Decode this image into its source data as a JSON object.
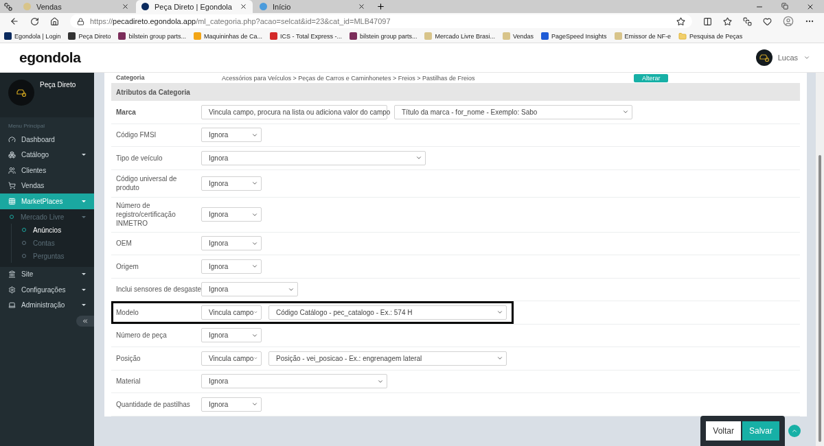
{
  "browser": {
    "tabs": [
      {
        "title": "Vendas",
        "selected": false
      },
      {
        "title": "Peça Direto | Egondola",
        "selected": true
      },
      {
        "title": "Início",
        "selected": false
      }
    ],
    "url": {
      "scheme": "https://",
      "host": "pecadireto.egondola.app",
      "path": "/ml_categoria.php?acao=selcat&id=23&cat_id=MLB47097"
    },
    "bookmarks": [
      {
        "label": "Egondola | Login"
      },
      {
        "label": "Peça Direto"
      },
      {
        "label": "bilstein group parts..."
      },
      {
        "label": "Maquininhas de Ca..."
      },
      {
        "label": "ICS - Total Express -..."
      },
      {
        "label": "bilstein group parts..."
      },
      {
        "label": "Mercado Livre Brasi..."
      },
      {
        "label": "Vendas"
      },
      {
        "label": "PageSpeed Insights"
      },
      {
        "label": "Emissor de NF-e"
      },
      {
        "label": "Pesquisa de Peças"
      }
    ]
  },
  "header": {
    "logo": "egondola",
    "user": "Lucas"
  },
  "sidebar": {
    "brand": "Peça Direto",
    "section_label": "Menu Principal",
    "items": [
      {
        "label": "Dashboard",
        "selected": false,
        "has_submenu": false
      },
      {
        "label": "Catálogo",
        "selected": false,
        "has_submenu": true
      },
      {
        "label": "Clientes",
        "selected": false,
        "has_submenu": false
      },
      {
        "label": "Vendas",
        "selected": false,
        "has_submenu": false
      },
      {
        "label": "MarketPlaces",
        "selected": true,
        "expanded": true,
        "has_submenu": true,
        "children": [
          {
            "label": "Mercado Livre",
            "expanded": true,
            "children": [
              {
                "label": "Anúncios",
                "selected": true
              },
              {
                "label": "Contas",
                "selected": false
              },
              {
                "label": "Perguntas",
                "selected": false
              }
            ]
          }
        ]
      },
      {
        "label": "Site",
        "selected": false,
        "has_submenu": true
      },
      {
        "label": "Configurações",
        "selected": false,
        "has_submenu": true
      },
      {
        "label": "Administração",
        "selected": false,
        "has_submenu": true
      }
    ]
  },
  "card": {
    "category": {
      "label": "Categoria",
      "value": "Acessórios para Veículos > Peças de Carros e Caminhonetes > Freios > Pastilhas de Freios",
      "button": "Alterar"
    },
    "section_title": "Atributos da Categoria",
    "attributes": [
      {
        "label": "Marca",
        "required": true,
        "highlighted": false,
        "selects": [
          {
            "value": "Vincula campo, procura na lista ou adiciona valor do campo",
            "kind": "wide"
          },
          {
            "value": "Título da marca - for_nome - Exemplo: Sabo",
            "kind": "long"
          }
        ]
      },
      {
        "label": "Código FMSI",
        "required": false,
        "highlighted": false,
        "selects": [
          {
            "value": "Ignora",
            "kind": "small"
          }
        ]
      },
      {
        "label": "Tipo de veículo",
        "required": false,
        "highlighted": false,
        "selects": [
          {
            "value": "Ignora",
            "kind": "large"
          }
        ]
      },
      {
        "label": "Código universal de produto",
        "required": false,
        "highlighted": false,
        "selects": [
          {
            "value": "Ignora",
            "kind": "small"
          }
        ]
      },
      {
        "label": "Número de registro/certificação INMETRO",
        "required": false,
        "highlighted": false,
        "selects": [
          {
            "value": "Ignora",
            "kind": "small"
          }
        ]
      },
      {
        "label": "OEM",
        "required": false,
        "highlighted": false,
        "selects": [
          {
            "value": "Ignora",
            "kind": "small"
          }
        ]
      },
      {
        "label": "Origem",
        "required": false,
        "highlighted": false,
        "selects": [
          {
            "value": "Ignora",
            "kind": "small"
          }
        ]
      },
      {
        "label": "Inclui sensores de desgaste",
        "required": false,
        "highlighted": false,
        "selects": [
          {
            "value": "Ignora",
            "kind": "medium"
          }
        ]
      },
      {
        "label": "Modelo",
        "required": false,
        "highlighted": true,
        "selects": [
          {
            "value": "Vincula campo",
            "kind": "small"
          },
          {
            "value": "Código Catálogo - pec_catalogo - Ex.: 574 H",
            "kind": "long"
          }
        ]
      },
      {
        "label": "Número de peça",
        "required": false,
        "highlighted": false,
        "selects": [
          {
            "value": "Ignora",
            "kind": "small"
          }
        ]
      },
      {
        "label": "Posição",
        "required": false,
        "highlighted": false,
        "selects": [
          {
            "value": "Vincula campo",
            "kind": "small"
          },
          {
            "value": "Posição - vei_posicao - Ex.: engrenagem lateral",
            "kind": "long"
          }
        ]
      },
      {
        "label": "Material",
        "required": false,
        "highlighted": false,
        "selects": [
          {
            "value": "Ignora",
            "kind": "wide"
          }
        ]
      },
      {
        "label": "Quantidade de pastilhas",
        "required": false,
        "highlighted": false,
        "selects": [
          {
            "value": "Ignora",
            "kind": "small"
          }
        ]
      }
    ]
  },
  "footer": {
    "back": "Voltar",
    "save": "Salvar"
  }
}
